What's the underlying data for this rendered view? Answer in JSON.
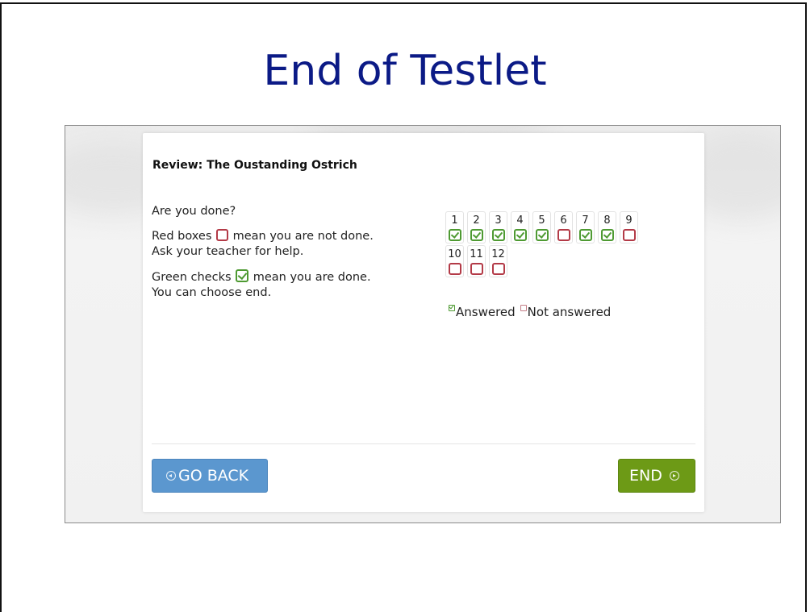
{
  "slide": {
    "title": "End of Testlet"
  },
  "review": {
    "title": "Review: The Oustanding Ostrich",
    "question": "Are you done?",
    "red_before": "Red boxes",
    "red_after": "mean you are not done. Ask your teacher for help.",
    "green_before": "Green checks",
    "green_after": "mean you are done. You can choose end."
  },
  "questions": [
    {
      "num": "1",
      "status": "answered"
    },
    {
      "num": "2",
      "status": "answered"
    },
    {
      "num": "3",
      "status": "answered"
    },
    {
      "num": "4",
      "status": "answered"
    },
    {
      "num": "5",
      "status": "answered"
    },
    {
      "num": "6",
      "status": "not_answered"
    },
    {
      "num": "7",
      "status": "answered"
    },
    {
      "num": "8",
      "status": "answered"
    },
    {
      "num": "9",
      "status": "not_answered"
    },
    {
      "num": "10",
      "status": "not_answered"
    },
    {
      "num": "11",
      "status": "not_answered"
    },
    {
      "num": "12",
      "status": "not_answered"
    }
  ],
  "legend": {
    "answered": "Answered",
    "not_answered": "Not answered"
  },
  "buttons": {
    "go_back": "GO BACK",
    "end": "END"
  },
  "colors": {
    "title": "#0b1a86",
    "answered": "#4e9a32",
    "not_answered": "#b33a47",
    "go_back": "#5b97cf",
    "end": "#6d9a16"
  },
  "icons": {
    "go_back": "arrow-left-circle-icon",
    "end": "arrow-right-circle-icon"
  }
}
